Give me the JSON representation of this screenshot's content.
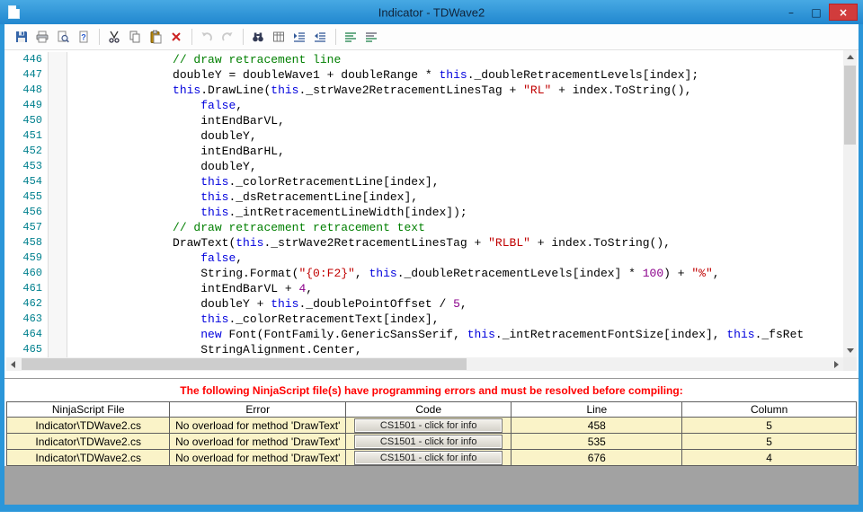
{
  "window": {
    "title": "Indicator - TDWave2",
    "controls": {
      "minimize": "–",
      "maximize": "□",
      "close": "×"
    }
  },
  "toolbar": {
    "icons": [
      "save",
      "print",
      "print-preview",
      "help",
      "|",
      "cut",
      "copy",
      "paste",
      "delete",
      "|",
      "undo",
      "redo",
      "|",
      "find",
      "goto-line",
      "indent",
      "outdent",
      "|",
      "comment",
      "uncomment"
    ],
    "disabled": [
      "undo",
      "redo"
    ]
  },
  "editor": {
    "lines": [
      {
        "num": 446,
        "ind": 15,
        "seg": [
          {
            "t": "// draw retracement line",
            "s": "com"
          }
        ]
      },
      {
        "num": 447,
        "ind": 15,
        "seg": [
          {
            "t": "doubleY = doubleWave1 + doubleRange * ",
            "s": "pln"
          },
          {
            "t": "this",
            "s": "kw"
          },
          {
            "t": "._doubleRetracementLevels[index];",
            "s": "pln"
          }
        ]
      },
      {
        "num": 448,
        "ind": 15,
        "seg": [
          {
            "t": "this",
            "s": "kw"
          },
          {
            "t": ".DrawLine(",
            "s": "pln"
          },
          {
            "t": "this",
            "s": "kw"
          },
          {
            "t": "._strWave2RetracementLinesTag + ",
            "s": "pln"
          },
          {
            "t": "\"RL\"",
            "s": "str"
          },
          {
            "t": " + index.ToString(),",
            "s": "pln"
          }
        ]
      },
      {
        "num": 449,
        "ind": 19,
        "seg": [
          {
            "t": "false",
            "s": "kw"
          },
          {
            "t": ",",
            "s": "pln"
          }
        ]
      },
      {
        "num": 450,
        "ind": 19,
        "seg": [
          {
            "t": "intEndBarVL,",
            "s": "pln"
          }
        ]
      },
      {
        "num": 451,
        "ind": 19,
        "seg": [
          {
            "t": "doubleY,",
            "s": "pln"
          }
        ]
      },
      {
        "num": 452,
        "ind": 19,
        "seg": [
          {
            "t": "intEndBarHL,",
            "s": "pln"
          }
        ]
      },
      {
        "num": 453,
        "ind": 19,
        "seg": [
          {
            "t": "doubleY,",
            "s": "pln"
          }
        ]
      },
      {
        "num": 454,
        "ind": 19,
        "seg": [
          {
            "t": "this",
            "s": "kw"
          },
          {
            "t": "._colorRetracementLine[index],",
            "s": "pln"
          }
        ]
      },
      {
        "num": 455,
        "ind": 19,
        "seg": [
          {
            "t": "this",
            "s": "kw"
          },
          {
            "t": "._dsRetracementLine[index],",
            "s": "pln"
          }
        ]
      },
      {
        "num": 456,
        "ind": 19,
        "seg": [
          {
            "t": "this",
            "s": "kw"
          },
          {
            "t": "._intRetracementLineWidth[index]);",
            "s": "pln"
          }
        ]
      },
      {
        "num": 457,
        "ind": 15,
        "seg": [
          {
            "t": "// draw retracement retracement text",
            "s": "com"
          }
        ]
      },
      {
        "num": 458,
        "ind": 15,
        "seg": [
          {
            "t": "DrawText(",
            "s": "pln"
          },
          {
            "t": "this",
            "s": "kw"
          },
          {
            "t": "._strWave2RetracementLinesTag + ",
            "s": "pln"
          },
          {
            "t": "\"RLBL\"",
            "s": "str"
          },
          {
            "t": " + index.ToString(),",
            "s": "pln"
          }
        ]
      },
      {
        "num": 459,
        "ind": 19,
        "seg": [
          {
            "t": "false",
            "s": "kw"
          },
          {
            "t": ",",
            "s": "pln"
          }
        ]
      },
      {
        "num": 460,
        "ind": 19,
        "seg": [
          {
            "t": "String.Format(",
            "s": "pln"
          },
          {
            "t": "\"{0:F2}\"",
            "s": "str"
          },
          {
            "t": ", ",
            "s": "pln"
          },
          {
            "t": "this",
            "s": "kw"
          },
          {
            "t": "._doubleRetracementLevels[index] * ",
            "s": "pln"
          },
          {
            "t": "100",
            "s": "num"
          },
          {
            "t": ") + ",
            "s": "pln"
          },
          {
            "t": "\"%\"",
            "s": "str"
          },
          {
            "t": ",",
            "s": "pln"
          }
        ]
      },
      {
        "num": 461,
        "ind": 19,
        "seg": [
          {
            "t": "intEndBarVL + ",
            "s": "pln"
          },
          {
            "t": "4",
            "s": "num"
          },
          {
            "t": ",",
            "s": "pln"
          }
        ]
      },
      {
        "num": 462,
        "ind": 19,
        "seg": [
          {
            "t": "doubleY + ",
            "s": "pln"
          },
          {
            "t": "this",
            "s": "kw"
          },
          {
            "t": "._doublePointOffset / ",
            "s": "pln"
          },
          {
            "t": "5",
            "s": "num"
          },
          {
            "t": ",",
            "s": "pln"
          }
        ]
      },
      {
        "num": 463,
        "ind": 19,
        "seg": [
          {
            "t": "this",
            "s": "kw"
          },
          {
            "t": "._colorRetracementText[index],",
            "s": "pln"
          }
        ]
      },
      {
        "num": 464,
        "ind": 19,
        "seg": [
          {
            "t": "new",
            "s": "kw"
          },
          {
            "t": " Font(FontFamily.GenericSansSerif, ",
            "s": "pln"
          },
          {
            "t": "this",
            "s": "kw"
          },
          {
            "t": "._intRetracementFontSize[index], ",
            "s": "pln"
          },
          {
            "t": "this",
            "s": "kw"
          },
          {
            "t": "._fsRet",
            "s": "pln"
          }
        ]
      },
      {
        "num": 465,
        "ind": 19,
        "seg": [
          {
            "t": "StringAlignment.Center,",
            "s": "pln"
          }
        ]
      }
    ]
  },
  "errors": {
    "header": "The following NinjaScript file(s) have programming errors and must be resolved before compiling:",
    "columns": [
      "NinjaScript File",
      "Error",
      "Code",
      "Line",
      "Column"
    ],
    "rows": [
      {
        "file": "Indicator\\TDWave2.cs",
        "error": "No overload for method 'DrawText'",
        "code": "CS1501 - click for info",
        "line": "458",
        "column": "5"
      },
      {
        "file": "Indicator\\TDWave2.cs",
        "error": "No overload for method 'DrawText'",
        "code": "CS1501 - click for info",
        "line": "535",
        "column": "5"
      },
      {
        "file": "Indicator\\TDWave2.cs",
        "error": "No overload for method 'DrawText'",
        "code": "CS1501 - click for info",
        "line": "676",
        "column": "4"
      }
    ]
  }
}
